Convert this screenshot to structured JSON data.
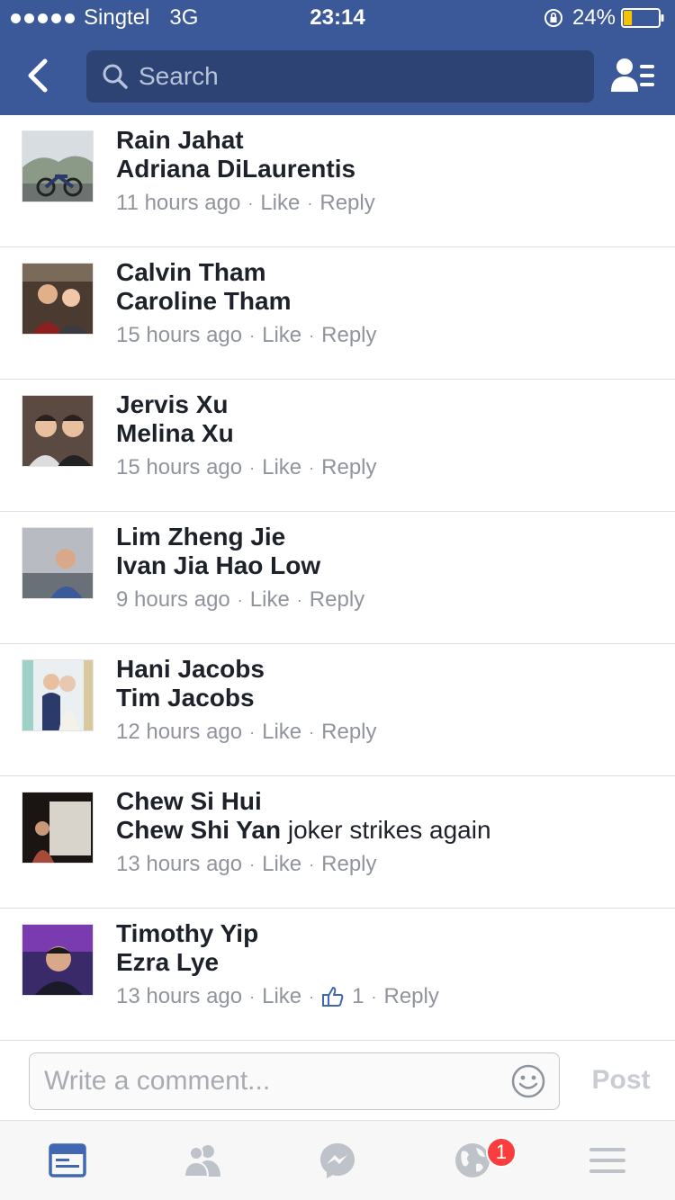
{
  "status_bar": {
    "carrier": "Singtel",
    "network": "3G",
    "time": "23:14",
    "battery_percent": "24%",
    "battery_level": 0.24,
    "signal_bars": 5
  },
  "nav": {
    "search_placeholder": "Search",
    "back_icon": "chevron-left-icon",
    "friends_icon": "friend-list-icon"
  },
  "comments": [
    {
      "name": "Rain Jahat",
      "mention": "Adriana DiLaurentis",
      "text": "",
      "time": "11 hours ago",
      "like_label": "Like",
      "reply_label": "Reply",
      "like_count": ""
    },
    {
      "name": "Calvin Tham",
      "mention": "Caroline Tham",
      "text": "",
      "time": "15 hours ago",
      "like_label": "Like",
      "reply_label": "Reply",
      "like_count": ""
    },
    {
      "name": "Jervis Xu",
      "mention": "Melina Xu",
      "text": "",
      "time": "15 hours ago",
      "like_label": "Like",
      "reply_label": "Reply",
      "like_count": ""
    },
    {
      "name": "Lim Zheng Jie",
      "mention": "Ivan Jia Hao Low",
      "text": "",
      "time": "9 hours ago",
      "like_label": "Like",
      "reply_label": "Reply",
      "like_count": ""
    },
    {
      "name": "Hani Jacobs",
      "mention": "Tim Jacobs",
      "text": "",
      "time": "12 hours ago",
      "like_label": "Like",
      "reply_label": "Reply",
      "like_count": ""
    },
    {
      "name": "Chew Si Hui",
      "mention": "Chew Shi Yan",
      "text": "joker strikes again",
      "time": "13 hours ago",
      "like_label": "Like",
      "reply_label": "Reply",
      "like_count": ""
    },
    {
      "name": "Timothy Yip",
      "mention": "Ezra Lye",
      "text": "",
      "time": "13 hours ago",
      "like_label": "Like",
      "reply_label": "Reply",
      "like_count": "1"
    }
  ],
  "composer": {
    "placeholder": "Write a comment...",
    "post_label": "Post",
    "emoji_icon": "smiley-icon"
  },
  "tab_bar": {
    "tabs": [
      {
        "icon": "news-feed-icon",
        "active": true
      },
      {
        "icon": "friends-icon",
        "active": false
      },
      {
        "icon": "messenger-icon",
        "active": false
      },
      {
        "icon": "globe-icon",
        "active": false,
        "badge": "1"
      },
      {
        "icon": "menu-icon",
        "active": false
      }
    ]
  },
  "colors": {
    "brand_blue": "#3b5998",
    "search_bg": "#2d4373",
    "meta_grey": "#90949c",
    "badge_red": "#fa3e3e",
    "battery_yellow": "#f5c400",
    "active_tab": "#4267b2",
    "inactive_tab": "#bec2c9"
  }
}
